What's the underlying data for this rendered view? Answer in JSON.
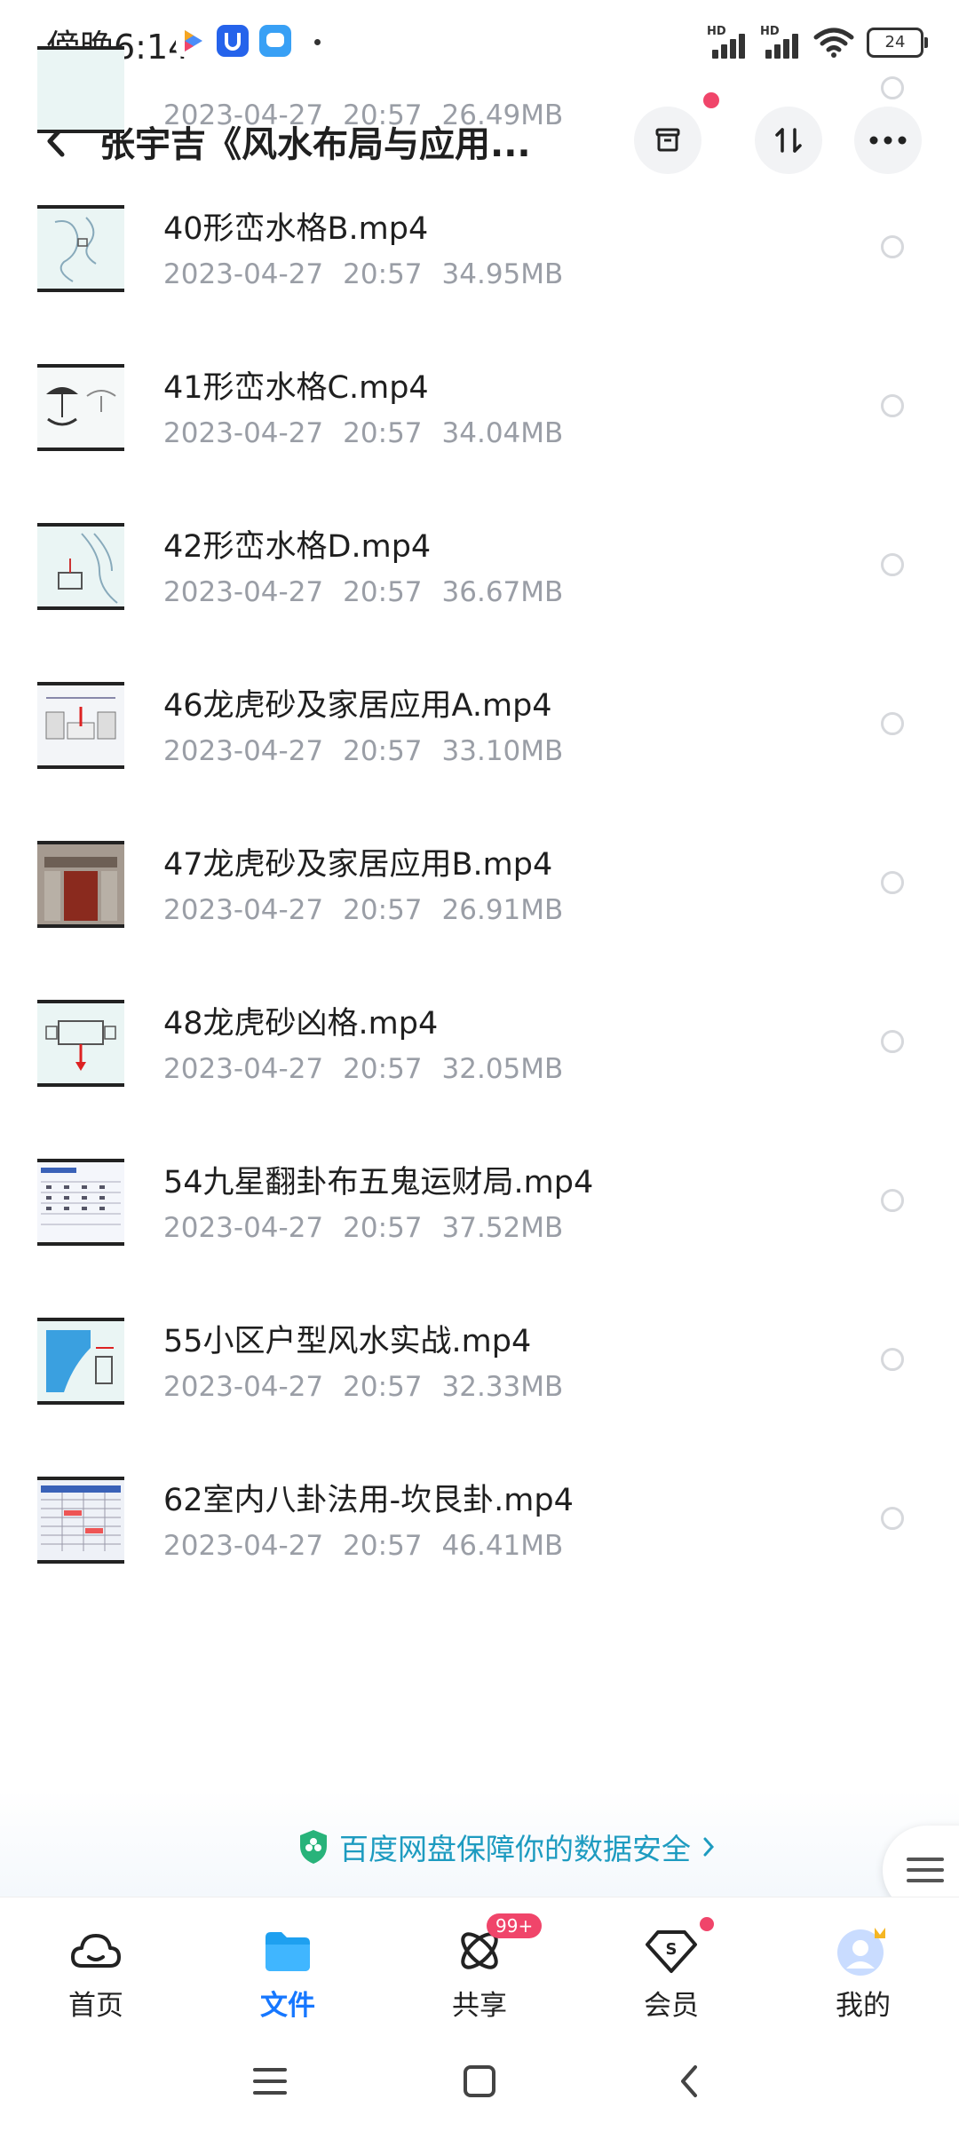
{
  "status_bar": {
    "time": "傍晚6:14",
    "signal1_label": "HD",
    "signal2_label": "HD",
    "battery": "24"
  },
  "header": {
    "title": "张宇吉《风水布局与应用..."
  },
  "files": [
    {
      "name": "",
      "date": "2023-04-27",
      "time": "20:57",
      "size": "26.49MB",
      "thumb": "partial"
    },
    {
      "name": "40形峦水格B.mp4",
      "date": "2023-04-27",
      "time": "20:57",
      "size": "34.95MB",
      "thumb": "sketch-river"
    },
    {
      "name": "41形峦水格C.mp4",
      "date": "2023-04-27",
      "time": "20:57",
      "size": "34.04MB",
      "thumb": "sketch-umbrella"
    },
    {
      "name": "42形峦水格D.mp4",
      "date": "2023-04-27",
      "time": "20:57",
      "size": "36.67MB",
      "thumb": "sketch-house"
    },
    {
      "name": "46龙虎砂及家居应用A.mp4",
      "date": "2023-04-27",
      "time": "20:57",
      "size": "33.10MB",
      "thumb": "diagram-red"
    },
    {
      "name": "47龙虎砂及家居应用B.mp4",
      "date": "2023-04-27",
      "time": "20:57",
      "size": "26.91MB",
      "thumb": "photo-door"
    },
    {
      "name": "48龙虎砂凶格.mp4",
      "date": "2023-04-27",
      "time": "20:57",
      "size": "32.05MB",
      "thumb": "diagram-arrow"
    },
    {
      "name": "54九星翻卦布五鬼运财局.mp4",
      "date": "2023-04-27",
      "time": "20:57",
      "size": "37.52MB",
      "thumb": "table"
    },
    {
      "name": "55小区户型风水实战.mp4",
      "date": "2023-04-27",
      "time": "20:57",
      "size": "32.33MB",
      "thumb": "floorplan"
    },
    {
      "name": "62室内八卦法用-坎艮卦.mp4",
      "date": "2023-04-27",
      "time": "20:57",
      "size": "46.41MB",
      "thumb": "table-red"
    }
  ],
  "banner": {
    "text": "百度网盘保障你的数据安全"
  },
  "nav": [
    {
      "label": "首页",
      "icon": "cloud-icon"
    },
    {
      "label": "文件",
      "icon": "folder-icon"
    },
    {
      "label": "共享",
      "icon": "share-icon",
      "badge": "99+"
    },
    {
      "label": "会员",
      "icon": "vip-icon"
    },
    {
      "label": "我的",
      "icon": "avatar-icon"
    }
  ],
  "colors": {
    "accent": "#1677ff",
    "badge": "#f0456a",
    "meta": "#9a9ea6",
    "banner": "#1d9bc0"
  }
}
